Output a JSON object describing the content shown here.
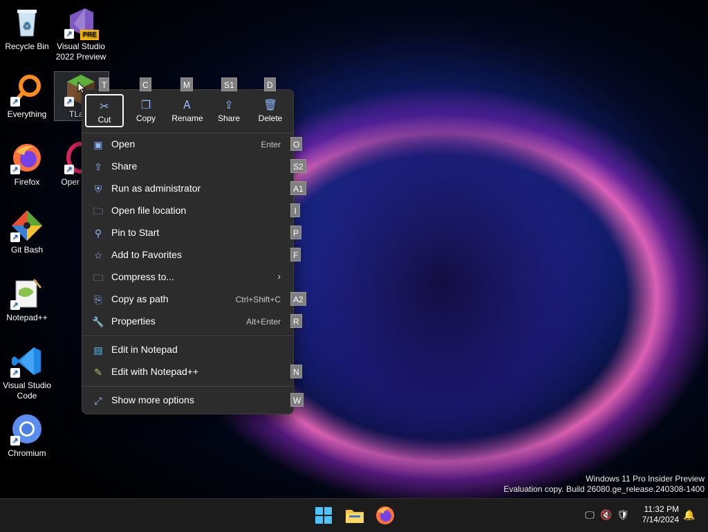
{
  "desktop": {
    "icons": [
      {
        "label": "Recycle Bin"
      },
      {
        "label": "Visual Studio 2022 Preview",
        "badge": "PRE"
      },
      {
        "label": "Everything"
      },
      {
        "label": "TLaun"
      },
      {
        "label": "Firefox"
      },
      {
        "label": "Oper Brow"
      },
      {
        "label": "Git Bash"
      },
      {
        "label": "Notepad++"
      },
      {
        "label": "Visual Studio Code"
      },
      {
        "label": "Chromium"
      }
    ]
  },
  "context_menu": {
    "quick_actions": [
      {
        "label": "Cut",
        "icon": "scissors-icon",
        "keytip": "T"
      },
      {
        "label": "Copy",
        "icon": "copy-icon",
        "keytip": "C"
      },
      {
        "label": "Rename",
        "icon": "rename-icon",
        "keytip": "M"
      },
      {
        "label": "Share",
        "icon": "share-icon",
        "keytip": "S1"
      },
      {
        "label": "Delete",
        "icon": "trash-icon",
        "keytip": "D"
      }
    ],
    "items": [
      {
        "label": "Open",
        "shortcut": "Enter",
        "keytip": "O"
      },
      {
        "label": "Share",
        "shortcut": "",
        "keytip": "S2"
      },
      {
        "label": "Run as administrator",
        "shortcut": "",
        "keytip": "A1"
      },
      {
        "label": "Open file location",
        "shortcut": "",
        "keytip": "I"
      },
      {
        "label": "Pin to Start",
        "shortcut": "",
        "keytip": "P"
      },
      {
        "label": "Add to Favorites",
        "shortcut": "",
        "keytip": "F"
      },
      {
        "label": "Compress to...",
        "shortcut": "",
        "keytip": ""
      },
      {
        "label": "Copy as path",
        "shortcut": "Ctrl+Shift+C",
        "keytip": "A2"
      },
      {
        "label": "Properties",
        "shortcut": "Alt+Enter",
        "keytip": "R"
      },
      {
        "label": "Edit in Notepad",
        "shortcut": "",
        "keytip": ""
      },
      {
        "label": "Edit with Notepad++",
        "shortcut": "",
        "keytip": "N"
      },
      {
        "label": "Show more options",
        "shortcut": "",
        "keytip": "W"
      }
    ]
  },
  "watermark": {
    "line1": "Windows 11 Pro Insider Preview",
    "line2": "Evaluation copy. Build 26080.ge_release.240308-1400"
  },
  "taskbar": {
    "time": "11:32 PM",
    "date": "7/14/2024"
  }
}
